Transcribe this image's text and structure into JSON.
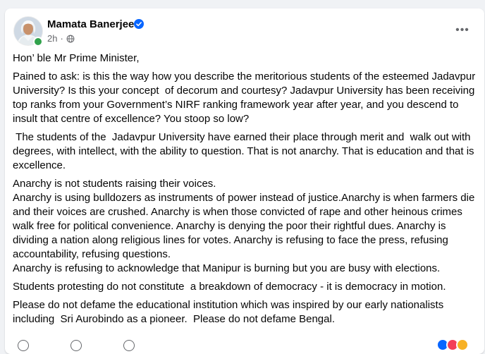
{
  "post": {
    "author": "Mamata Banerjee",
    "timestamp": "2h",
    "separator": "·",
    "more_label": "•••",
    "paragraphs": [
      "Hon’ ble Mr Prime Minister,",
      "Pained to ask: is this the way how you describe the meritorious students of the esteemed Jadavpur University? Is this your concept  of decorum and courtesy? Jadavpur University has been receiving top ranks from your Government’s NIRF ranking framework year after year, and you descend to insult that centre of excellence? You stoop so low?",
      " The students of the  Jadavpur University have earned their place through merit and  walk out with degrees, with intellect, with the ability to question. That is not anarchy. That is education and that is excellence.",
      "Anarchy is not students raising their voices.\nAnarchy is using bulldozers as instruments of power instead of justice.Anarchy is when farmers die and their voices are crushed. Anarchy is when those convicted of rape and other heinous crimes walk free for political convenience. Anarchy is denying the poor their rightful dues. Anarchy is dividing a nation along religious lines for votes. Anarchy is refusing to face the press, refusing accountability, refusing questions.\nAnarchy is refusing to acknowledge that Manipur is burning but you are busy with elections.",
      "Students protesting do not constitute  a breakdown of democracy - it is democracy in motion.",
      "Please do not defame the educational institution which was inspired by our early nationalists including  Sri Aurobindo as a pioneer.  Please do not defame Bengal."
    ]
  },
  "icons": {
    "verified": "verified-badge-icon",
    "privacy": "globe-icon",
    "more": "more-options-icon",
    "like": "like-icon",
    "comment": "comment-icon",
    "share": "share-icon"
  },
  "colors": {
    "verified_blue": "#0866ff",
    "online_green": "#31a24c",
    "secondary_text": "#65676b",
    "primary_text": "#050505",
    "page_background": "#f0f2f5"
  }
}
